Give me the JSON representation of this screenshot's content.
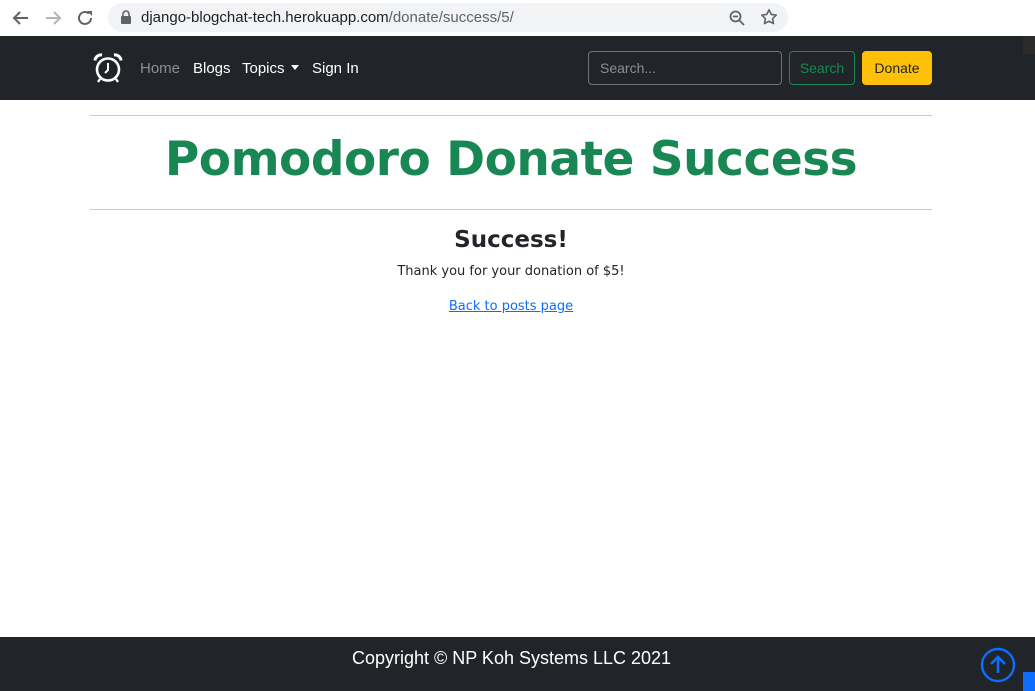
{
  "browser": {
    "url_host": "django-blogchat-tech.herokuapp.com",
    "url_path": "/donate/success/5/",
    "back_icon": "arrow-left-icon",
    "forward_icon": "arrow-right-icon",
    "reload_icon": "reload-icon",
    "lock_icon": "lock-icon",
    "zoom_icon": "zoom-out-icon",
    "bookmark_icon": "star-icon"
  },
  "navbar": {
    "brand_icon": "alarm-clock-icon",
    "links": {
      "home": "Home",
      "blogs": "Blogs",
      "topics": "Topics",
      "signin": "Sign In"
    },
    "search_placeholder": "Search...",
    "search_button": "Search",
    "donate_button": "Donate"
  },
  "main": {
    "title": "Pomodoro Donate Success",
    "heading": "Success!",
    "message": "Thank you for your donation of $5!",
    "back_link": "Back to posts page"
  },
  "footer": {
    "copyright": "Copyright © NP Koh Systems LLC 2021",
    "scroll_top_icon": "arrow-up-circle-icon"
  },
  "colors": {
    "navbar_bg": "#212529",
    "title_green": "#198754",
    "donate_yellow": "#ffc107",
    "link_blue": "#0d6efd"
  }
}
